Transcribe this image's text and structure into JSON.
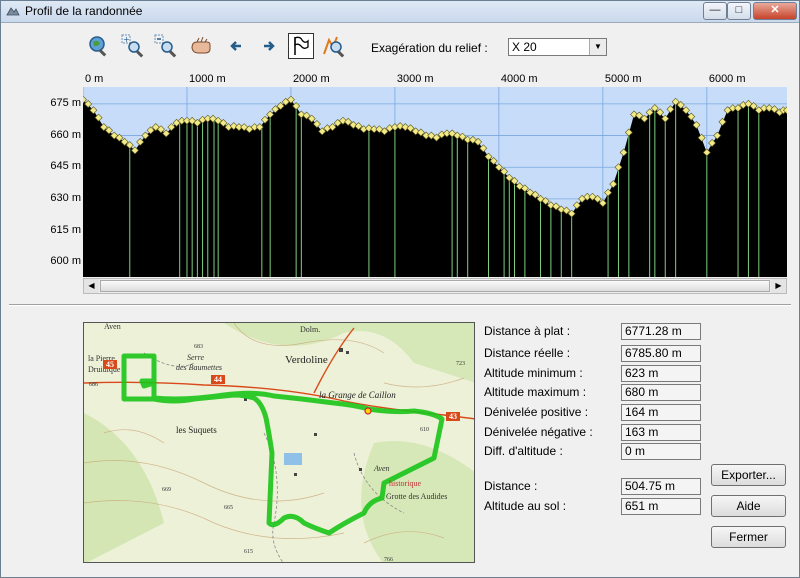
{
  "window": {
    "title": "Profil de la randonnée",
    "minimize": "—",
    "maximize": "□",
    "close": "✕"
  },
  "toolbar": {
    "icons": [
      "zoom-globe-icon",
      "zoom-in-icon",
      "zoom-out-icon",
      "pan-hand-icon",
      "arrow-left-icon",
      "arrow-right-icon",
      "profile-flag-icon",
      "zoom-relief-icon"
    ],
    "exaggeration_label": "Exagération du relief :",
    "exaggeration_value": "X 20"
  },
  "chart_data": {
    "type": "area",
    "title": "",
    "xlabel": "",
    "ylabel": "",
    "x_ticks": [
      "0 m",
      "1000 m",
      "2000 m",
      "3000 m",
      "4000 m",
      "5000 m",
      "6000 m"
    ],
    "x_tick_values": [
      0,
      1000,
      2000,
      3000,
      4000,
      5000,
      6000
    ],
    "y_ticks": [
      "675 m",
      "660 m",
      "645 m",
      "630 m",
      "615 m",
      "600 m"
    ],
    "y_tick_values": [
      675,
      660,
      645,
      630,
      615,
      600
    ],
    "xlim": [
      0,
      6771
    ],
    "ylim": [
      593,
      683
    ],
    "colors": {
      "sky": "#c6dcf8",
      "terrain": "#000000",
      "points": "#f2e98a",
      "waypoints": "#7fcf7f",
      "grid": "#7aa7e0"
    },
    "x": [
      0,
      100,
      200,
      300,
      400,
      500,
      600,
      700,
      800,
      900,
      1000,
      1100,
      1200,
      1300,
      1400,
      1500,
      1600,
      1700,
      1800,
      1900,
      2000,
      2100,
      2200,
      2300,
      2400,
      2500,
      2600,
      2700,
      2800,
      2900,
      3000,
      3100,
      3200,
      3300,
      3400,
      3500,
      3600,
      3700,
      3800,
      3900,
      4000,
      4100,
      4200,
      4300,
      4400,
      4500,
      4600,
      4700,
      4800,
      4900,
      5000,
      5100,
      5200,
      5300,
      5400,
      5500,
      5600,
      5700,
      5800,
      5900,
      6000,
      6100,
      6200,
      6300,
      6400,
      6500,
      6600,
      6700,
      6771
    ],
    "y": [
      677,
      672,
      664,
      660,
      657,
      653,
      660,
      664,
      661,
      666,
      667,
      666,
      668,
      667,
      664,
      664,
      663,
      664,
      670,
      674,
      677,
      670,
      668,
      662,
      664,
      667,
      665,
      663,
      663,
      662,
      664,
      664,
      662,
      660,
      659,
      661,
      660,
      658,
      657,
      650,
      645,
      640,
      636,
      633,
      630,
      627,
      625,
      623,
      630,
      631,
      628,
      637,
      652,
      670,
      668,
      673,
      668,
      676,
      672,
      665,
      652,
      660,
      672,
      673,
      675,
      672,
      673,
      671,
      672
    ],
    "waypoint_x": [
      450,
      930,
      1000,
      1050,
      1100,
      1150,
      1200,
      1260,
      1300,
      1720,
      1800,
      2050,
      2100,
      2750,
      3000,
      3550,
      3600,
      3700,
      3900,
      4050,
      4100,
      4150,
      4250,
      4400,
      4500,
      4600,
      4700,
      5050,
      5150,
      5250,
      5450,
      5500,
      5600,
      5700,
      6000,
      6300,
      6400,
      6500
    ]
  },
  "map": {
    "labels": {
      "aven_top": "Aven",
      "dolm": "Dolm.",
      "la_pierre": "la Pierre",
      "druidique": "Druidique",
      "serre": "Serre",
      "des_baumettes": "des Baumettes",
      "verdoline": "Verdoline",
      "grange": "la Grange de Caillon",
      "les_suquets": "les Suquets",
      "aven": "Aven",
      "historique": "historique",
      "audides": "Grotte des Audides",
      "road_44": "44",
      "road_45": "45",
      "road_43": "43",
      "alt_683": "683",
      "alt_723": "723",
      "alt_686": "686",
      "alt_669": "669",
      "alt_665": "665",
      "alt_615": "615",
      "alt_766": "766",
      "alt_610": "610"
    }
  },
  "stats": [
    {
      "label": "Distance à plat :",
      "value": "6771.28 m"
    },
    {
      "label": "Distance réelle :",
      "value": "6785.80 m"
    },
    {
      "label": "Altitude minimum :",
      "value": "623 m"
    },
    {
      "label": "Altitude maximum :",
      "value": "680 m"
    },
    {
      "label": "Dénivelée positive :",
      "value": "164 m"
    },
    {
      "label": "Dénivelée négative :",
      "value": "163 m"
    },
    {
      "label": "Diff. d'altitude :",
      "value": "0 m"
    }
  ],
  "cursor_stats": [
    {
      "label": "Distance :",
      "value": "504.75 m"
    },
    {
      "label": "Altitude au sol :",
      "value": "651 m"
    }
  ],
  "buttons": {
    "export": "Exporter...",
    "help": "Aide",
    "close": "Fermer"
  }
}
